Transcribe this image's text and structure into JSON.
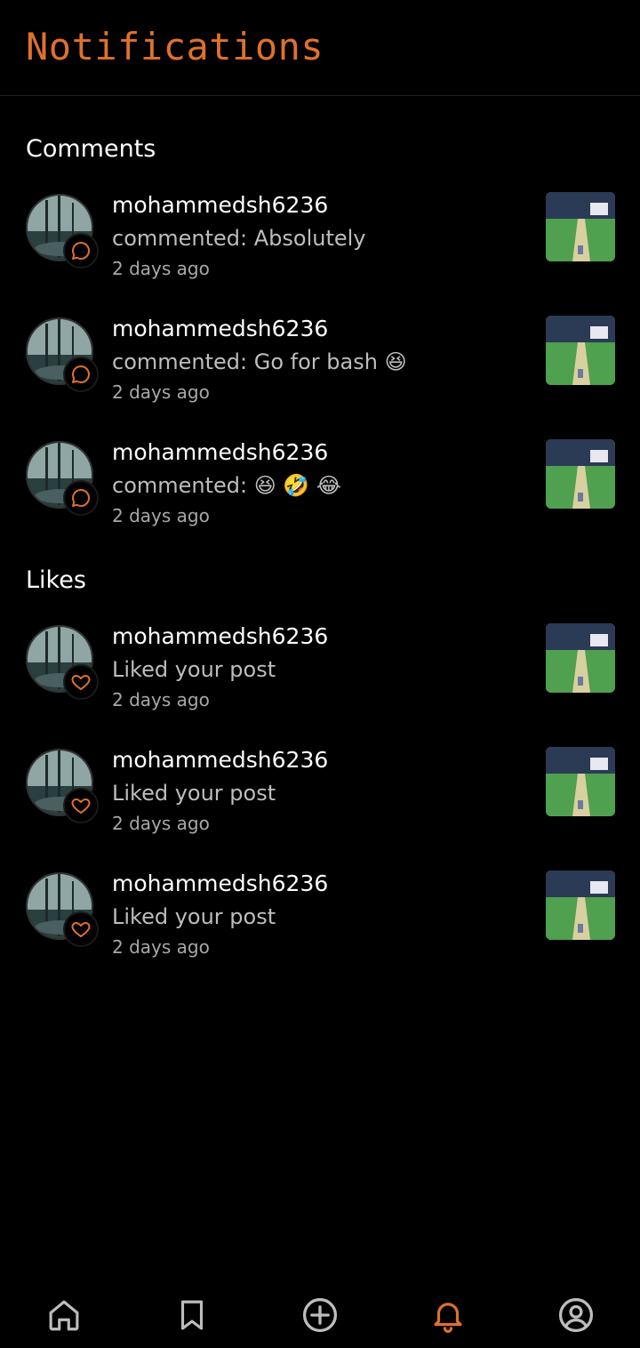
{
  "header": {
    "title": "Notifications"
  },
  "sections": {
    "comments": {
      "title": "Comments",
      "items": [
        {
          "username": "mohammedsh6236",
          "message": "commented: Absolutely",
          "time": "2 days ago"
        },
        {
          "username": "mohammedsh6236",
          "message": "commented: Go for bash 😆",
          "time": "2 days ago"
        },
        {
          "username": "mohammedsh6236",
          "message": "commented: 😆 🤣 😂",
          "time": "2 days ago"
        }
      ]
    },
    "likes": {
      "title": "Likes",
      "items": [
        {
          "username": "mohammedsh6236",
          "message": "Liked your post",
          "time": "2 days ago"
        },
        {
          "username": "mohammedsh6236",
          "message": "Liked your post",
          "time": "2 days ago"
        },
        {
          "username": "mohammedsh6236",
          "message": "Liked your post",
          "time": "2 days ago"
        }
      ]
    }
  },
  "nav": {
    "items": [
      "home-icon",
      "bookmark-icon",
      "add-circle-icon",
      "bell-icon",
      "profile-icon"
    ],
    "active": "bell-icon"
  },
  "colors": {
    "accent": "#e0712a",
    "background": "#000000",
    "muted": "#bdbdbd"
  }
}
